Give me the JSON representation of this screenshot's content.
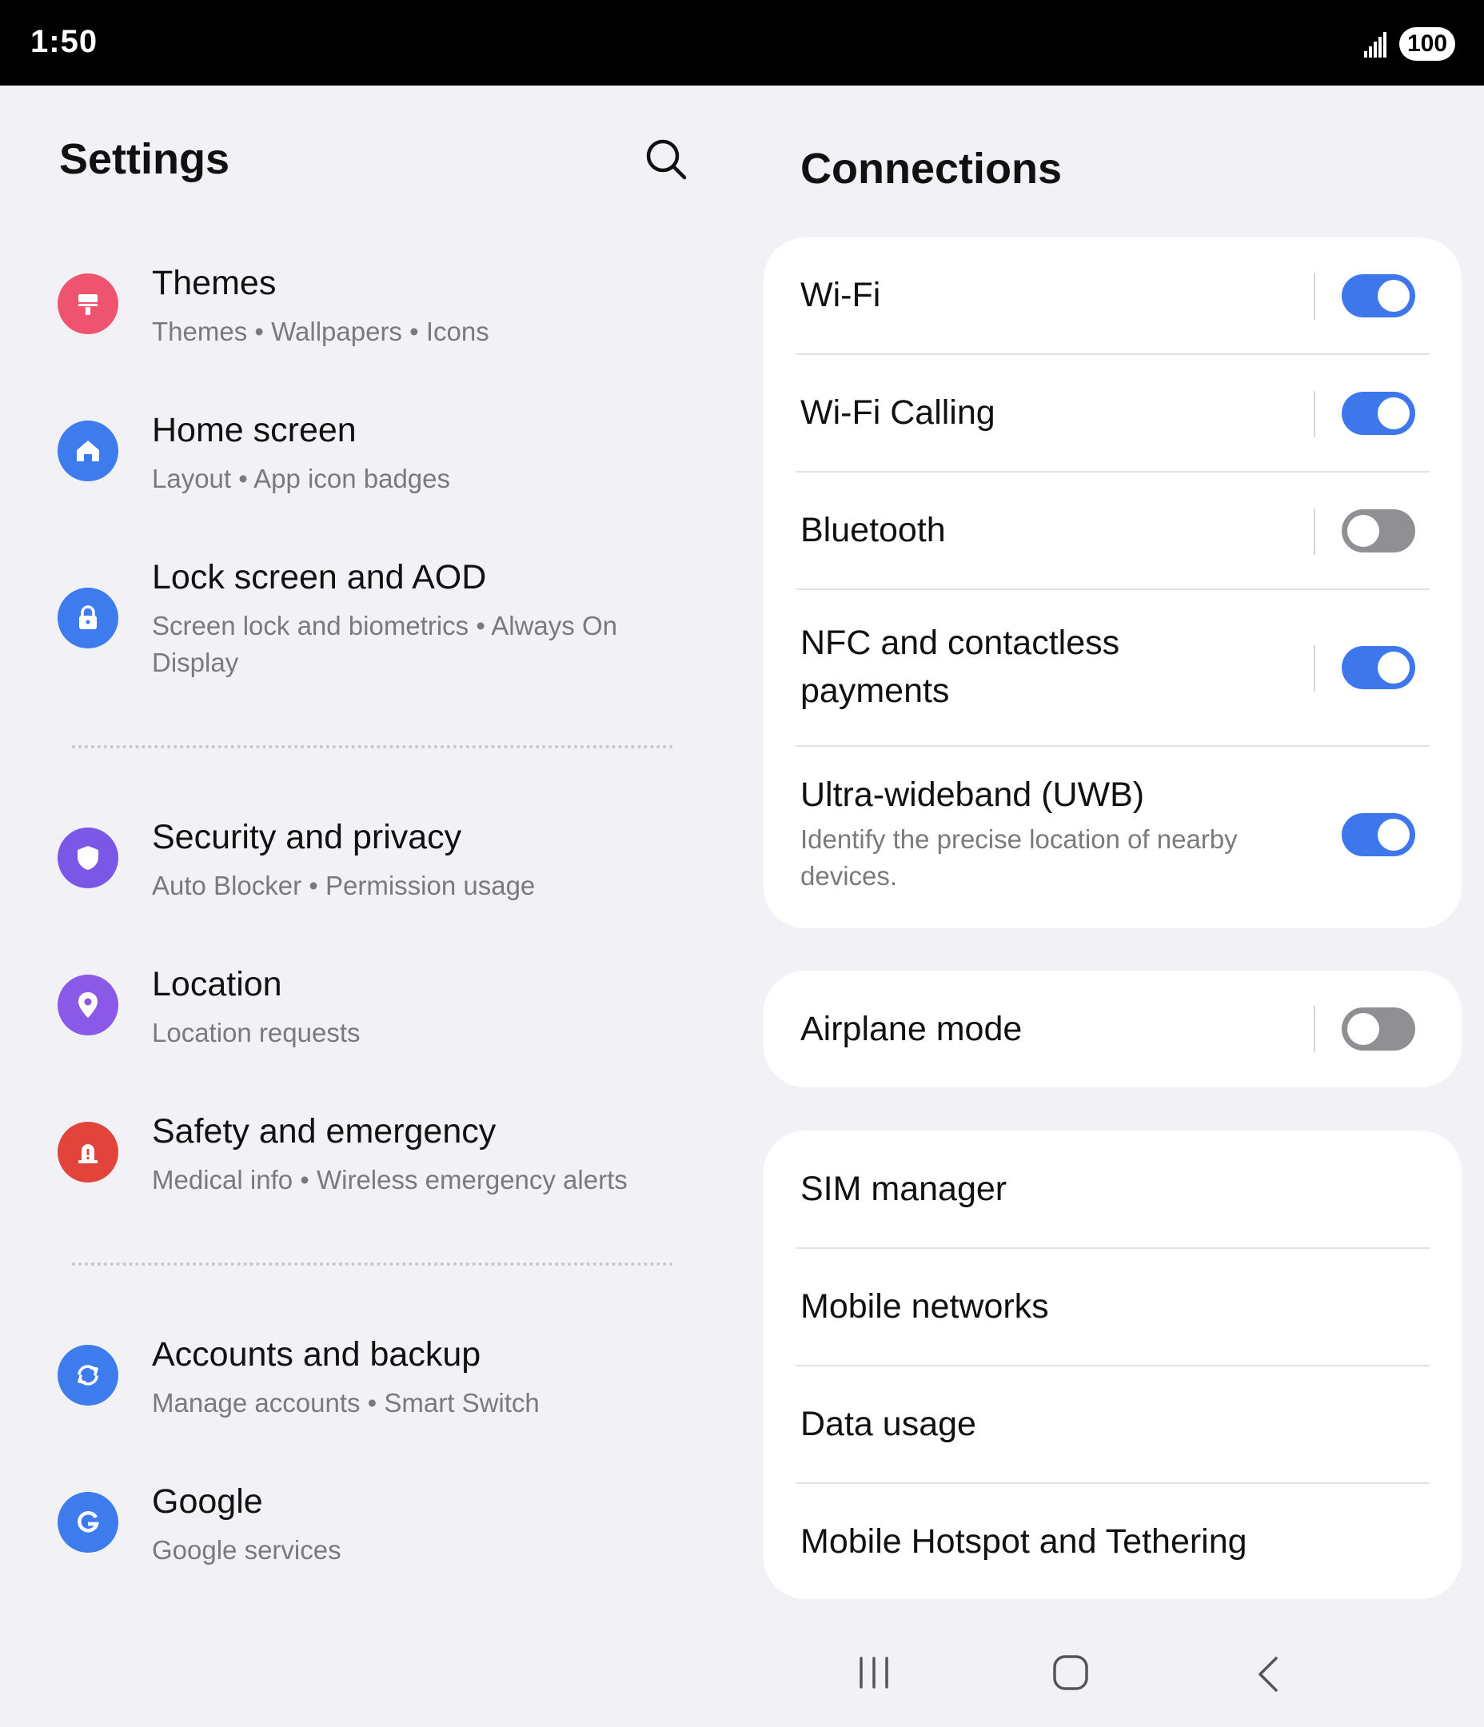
{
  "status_bar": {
    "time": "1:50",
    "battery": "100",
    "signal_icon": "signal-icon"
  },
  "left_pane": {
    "title": "Settings",
    "search_icon": "search-icon",
    "items": [
      {
        "title": "Themes",
        "subtitle": "Themes  •  Wallpapers  •  Icons",
        "icon": "paint-roller-icon",
        "color": "#ee5470"
      },
      {
        "title": "Home screen",
        "subtitle": "Layout  •  App icon badges",
        "icon": "home-icon",
        "color": "#3e7bed"
      },
      {
        "title": "Lock screen and AOD",
        "subtitle": "Screen lock and biometrics  •  Always On Display",
        "icon": "lock-icon",
        "color": "#3e7bed"
      },
      {
        "title": "Security and privacy",
        "subtitle": "Auto Blocker  •  Permission usage",
        "icon": "shield-icon",
        "color": "#7b57e8"
      },
      {
        "title": "Location",
        "subtitle": "Location requests",
        "icon": "location-pin-icon",
        "color": "#8b59e8"
      },
      {
        "title": "Safety and emergency",
        "subtitle": "Medical info  •  Wireless emergency alerts",
        "icon": "emergency-siren-icon",
        "color": "#e2443c"
      },
      {
        "title": "Accounts and backup",
        "subtitle": "Manage accounts  •  Smart Switch",
        "icon": "sync-icon",
        "color": "#3e7bed"
      },
      {
        "title": "Google",
        "subtitle": "Google services",
        "icon": "google-icon",
        "color": "#3e7bed"
      }
    ]
  },
  "right_pane": {
    "title": "Connections",
    "connections_card": [
      {
        "label": "Wi-Fi",
        "toggle": true
      },
      {
        "label": "Wi-Fi Calling",
        "toggle": true
      },
      {
        "label": "Bluetooth",
        "toggle": false
      },
      {
        "label": "NFC and contactless payments",
        "toggle": true
      },
      {
        "label": "Ultra-wideband (UWB)",
        "subtitle": "Identify the precise location of nearby devices.",
        "toggle": true
      }
    ],
    "airplane_card": {
      "label": "Airplane mode",
      "toggle": false
    },
    "network_card": [
      {
        "label": "SIM manager"
      },
      {
        "label": "Mobile networks"
      },
      {
        "label": "Data usage"
      },
      {
        "label": "Mobile Hotspot and Tethering"
      }
    ]
  },
  "nav_bar": {
    "icons": [
      "recent-apps-icon",
      "home-button-icon",
      "back-icon"
    ]
  },
  "colors": {
    "accent": "#3e77ec",
    "toggle_off": "#8f8f94",
    "background": "#f2f2f6"
  }
}
